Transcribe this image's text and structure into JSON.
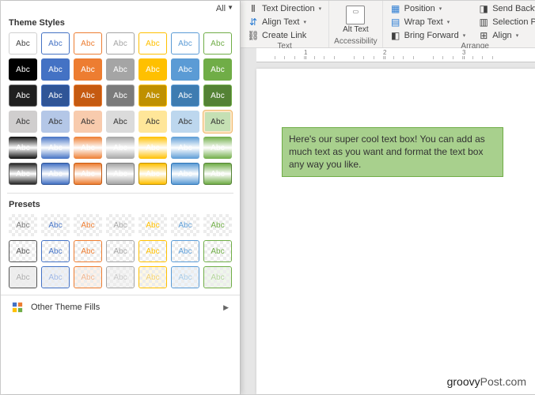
{
  "header": {
    "filter": "All"
  },
  "sections": {
    "theme": "Theme Styles",
    "presets": "Presets"
  },
  "swatch_label": "Abc",
  "theme_rows": [
    [
      {
        "bg": "#ffffff",
        "fg": "#404040",
        "bd": "#d0d0d0",
        "type": "o"
      },
      {
        "bg": "#ffffff",
        "fg": "#4472c4",
        "bd": "#4472c4",
        "type": "o"
      },
      {
        "bg": "#ffffff",
        "fg": "#ed7d31",
        "bd": "#ed7d31",
        "type": "o"
      },
      {
        "bg": "#ffffff",
        "fg": "#a5a5a5",
        "bd": "#a5a5a5",
        "type": "o"
      },
      {
        "bg": "#ffffff",
        "fg": "#ffc000",
        "bd": "#ffc000",
        "type": "o"
      },
      {
        "bg": "#ffffff",
        "fg": "#5b9bd5",
        "bd": "#5b9bd5",
        "type": "o"
      },
      {
        "bg": "#ffffff",
        "fg": "#70ad47",
        "bd": "#70ad47",
        "type": "o"
      }
    ],
    [
      {
        "bg": "#000000",
        "fg": "#ffffff"
      },
      {
        "bg": "#4472c4",
        "fg": "#ffffff"
      },
      {
        "bg": "#ed7d31",
        "fg": "#ffffff"
      },
      {
        "bg": "#a5a5a5",
        "fg": "#ffffff"
      },
      {
        "bg": "#ffc000",
        "fg": "#ffffff"
      },
      {
        "bg": "#5b9bd5",
        "fg": "#ffffff"
      },
      {
        "bg": "#70ad47",
        "fg": "#ffffff"
      }
    ],
    [
      {
        "bg": "#1f1f1f",
        "fg": "#ffffff",
        "bd": "#6b6b6b"
      },
      {
        "bg": "#2f5597",
        "fg": "#ffffff",
        "bd": "#4472c4"
      },
      {
        "bg": "#c55a11",
        "fg": "#ffffff",
        "bd": "#ed7d31"
      },
      {
        "bg": "#7b7b7b",
        "fg": "#ffffff",
        "bd": "#a5a5a5"
      },
      {
        "bg": "#bf9000",
        "fg": "#ffffff",
        "bd": "#ffc000"
      },
      {
        "bg": "#3e7cb1",
        "fg": "#ffffff",
        "bd": "#5b9bd5"
      },
      {
        "bg": "#548235",
        "fg": "#ffffff",
        "bd": "#70ad47"
      }
    ],
    [
      {
        "bg": "#d0cece",
        "fg": "#333333"
      },
      {
        "bg": "#b4c7e7",
        "fg": "#333333"
      },
      {
        "bg": "#f8cbad",
        "fg": "#333333"
      },
      {
        "bg": "#dbdbdb",
        "fg": "#333333"
      },
      {
        "bg": "#ffe699",
        "fg": "#333333"
      },
      {
        "bg": "#bdd7ee",
        "fg": "#333333"
      },
      {
        "bg": "#c5e0b4",
        "fg": "#333333",
        "hover": true
      }
    ],
    [
      {
        "bg": "#0d0d0d",
        "fg": "#ffffff",
        "grad": true
      },
      {
        "bg": "#4472c4",
        "fg": "#ffffff",
        "grad": true
      },
      {
        "bg": "#ed7d31",
        "fg": "#ffffff",
        "grad": true
      },
      {
        "bg": "#a5a5a5",
        "fg": "#ffffff",
        "grad": true
      },
      {
        "bg": "#ffc000",
        "fg": "#ffffff",
        "grad": true
      },
      {
        "bg": "#5b9bd5",
        "fg": "#ffffff",
        "grad": true
      },
      {
        "bg": "#70ad47",
        "fg": "#ffffff",
        "grad": true
      }
    ],
    [
      {
        "bg": "#262626",
        "fg": "#ffffff",
        "grad": true,
        "bd": "#555"
      },
      {
        "bg": "#4472c4",
        "fg": "#ffffff",
        "grad": true,
        "bd": "#2f5597"
      },
      {
        "bg": "#ed7d31",
        "fg": "#ffffff",
        "grad": true,
        "bd": "#c55a11"
      },
      {
        "bg": "#a5a5a5",
        "fg": "#ffffff",
        "grad": true,
        "bd": "#7b7b7b"
      },
      {
        "bg": "#ffc000",
        "fg": "#ffffff",
        "grad": true,
        "bd": "#bf9000"
      },
      {
        "bg": "#5b9bd5",
        "fg": "#ffffff",
        "grad": true,
        "bd": "#2e75b6"
      },
      {
        "bg": "#70ad47",
        "fg": "#ffffff",
        "grad": true,
        "bd": "#548235"
      }
    ]
  ],
  "preset_rows": [
    [
      {
        "fg": "#777",
        "bd": "transparent"
      },
      {
        "fg": "#4472c4",
        "bd": "transparent"
      },
      {
        "fg": "#ed7d31",
        "bd": "transparent"
      },
      {
        "fg": "#a5a5a5",
        "bd": "transparent"
      },
      {
        "fg": "#ffc000",
        "bd": "transparent"
      },
      {
        "fg": "#5b9bd5",
        "bd": "transparent"
      },
      {
        "fg": "#70ad47",
        "bd": "transparent"
      }
    ],
    [
      {
        "fg": "#555",
        "bd": "#555"
      },
      {
        "fg": "#4472c4",
        "bd": "#4472c4"
      },
      {
        "fg": "#ed7d31",
        "bd": "#ed7d31"
      },
      {
        "fg": "#a5a5a5",
        "bd": "#a5a5a5"
      },
      {
        "fg": "#ffc000",
        "bd": "#ffc000"
      },
      {
        "fg": "#5b9bd5",
        "bd": "#5b9bd5"
      },
      {
        "fg": "#70ad47",
        "bd": "#70ad47"
      }
    ],
    [
      {
        "fg": "#aaa",
        "bd": "#555",
        "tint": "#e0e0e0"
      },
      {
        "fg": "#9cb4e2",
        "bd": "#4472c4",
        "tint": "#dae3f3"
      },
      {
        "fg": "#f0b690",
        "bd": "#ed7d31",
        "tint": "#fbe5d6"
      },
      {
        "fg": "#c8c8c8",
        "bd": "#a5a5a5",
        "tint": "#ededed"
      },
      {
        "fg": "#f2d272",
        "bd": "#ffc000",
        "tint": "#fff2cc"
      },
      {
        "fg": "#a6c8e4",
        "bd": "#5b9bd5",
        "tint": "#deebf7"
      },
      {
        "fg": "#b4d49c",
        "bd": "#70ad47",
        "tint": "#e2f0d9"
      }
    ]
  ],
  "footer": {
    "other_fills": "Other Theme Fills"
  },
  "ribbon": {
    "text_direction": "Text Direction",
    "align_text": "Align Text",
    "create_link": "Create Link",
    "text_group": "Text",
    "alt_text": "Alt\nText",
    "accessibility_group": "Accessibility",
    "position": "Position",
    "wrap_text": "Wrap Text",
    "bring_forward": "Bring Forward",
    "send_backward": "Send Backward",
    "selection_pane": "Selection Pane",
    "align": "Align",
    "arrange_group": "Arrange"
  },
  "ruler": {
    "marks": [
      "1",
      "2",
      "3"
    ]
  },
  "textbox": "Here's our super cool text box! You can add as much text as you want and format the text box any way you like.",
  "watermark": {
    "brand": "groovy",
    "suffix": "Post.com"
  }
}
